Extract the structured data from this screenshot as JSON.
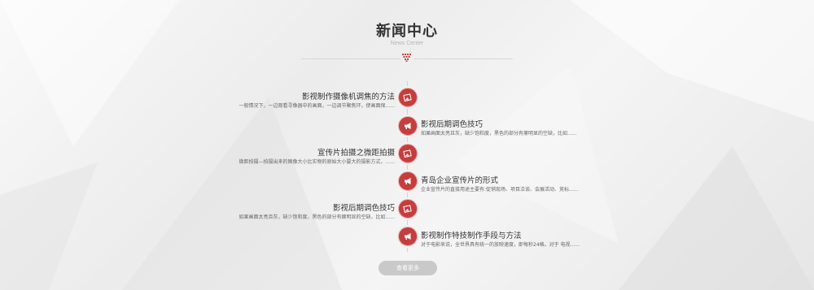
{
  "section": {
    "title": "新闻中心",
    "subtitle": "News Center"
  },
  "news": [
    {
      "title": "影视制作摄像机调焦的方法",
      "desc": "一般情况下，一边观看寻像器中的画面，一边调节聚焦环，使画面保......",
      "side": "left",
      "icon": "photo-icon"
    },
    {
      "title": "影视后期调色技巧",
      "desc": "如果画面太亮且灰，缺少饱和度，黑色的部分有瘰明显的空缺，比如......",
      "side": "right",
      "icon": "megaphone-icon"
    },
    {
      "title": "宣传片拍摄之微距拍摄",
      "desc": "微距拍摄—拍摄出来的图像大小比实物的原始大小要大的摄影方式，......",
      "side": "left",
      "icon": "photo-icon"
    },
    {
      "title": "青岛企业宣传片的形式",
      "desc": "企业宣传片的直接用途主要有:促销现场、项目洽谈、会展活动、竞标......",
      "side": "right",
      "icon": "megaphone-icon"
    },
    {
      "title": "影视后期调色技巧",
      "desc": "如果画面太亮且灰，缺少饱和度，黑色的部分有瘰明显的空缺，比如......",
      "side": "left",
      "icon": "photo-icon"
    },
    {
      "title": "影视制作特技制作手段与方法",
      "desc": "对于电影来说，全世界具有统一的放映速度，即每秒24格。对于 电视......",
      "side": "right",
      "icon": "megaphone-icon"
    }
  ],
  "more_button": {
    "label": "查看更多"
  },
  "colors": {
    "accent": "#c63d3d",
    "button": "#c9c9c9"
  }
}
